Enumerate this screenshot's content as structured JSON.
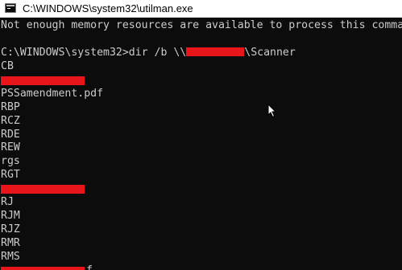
{
  "window": {
    "title": "C:\\WINDOWS\\system32\\utilman.exe",
    "icon": "console-window-icon"
  },
  "console": {
    "error_line": "Not enough memory resources are available to process this command.",
    "blank_line": "",
    "command_prefix": "C:\\WINDOWS\\system32>dir /b \\\\",
    "command_suffix": "\\Scanner",
    "entries": [
      "CB",
      "",
      "PSSamendment.pdf",
      "RBP",
      "RCZ",
      "RDE",
      "REW",
      "rgs",
      "RGT",
      "",
      "RJ",
      "RJM",
      "RJZ",
      "RMR",
      "RMS",
      "f"
    ],
    "redaction_color": "#e8161b",
    "text_color": "#cccccc",
    "background_color": "#0c0c0c"
  },
  "pointer": {
    "icon": "mouse-pointer-icon"
  }
}
